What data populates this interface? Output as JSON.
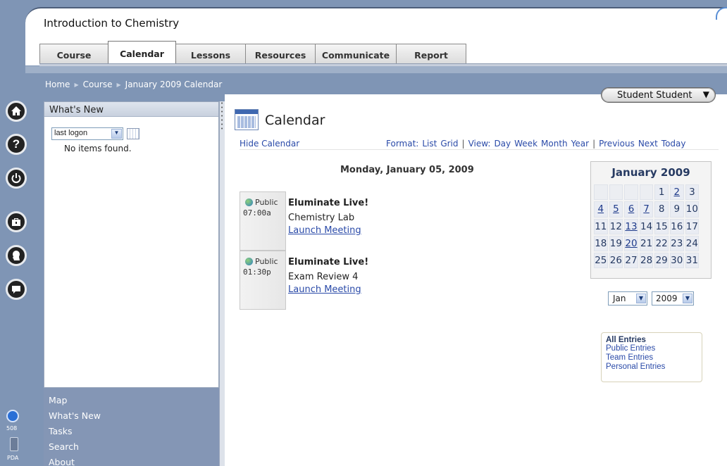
{
  "course": {
    "title": "Introduction to Chemistry"
  },
  "tabs": [
    {
      "label": "Course",
      "active": false
    },
    {
      "label": "Calendar",
      "active": true
    },
    {
      "label": "Lessons",
      "active": false
    },
    {
      "label": "Resources",
      "active": false
    },
    {
      "label": "Communicate",
      "active": false
    },
    {
      "label": "Report",
      "active": false
    }
  ],
  "breadcrumb": [
    "Home",
    "Course",
    "January 2009 Calendar"
  ],
  "user": {
    "name": "Student Student"
  },
  "rail": {
    "accessibility_label": "508",
    "pda_label": "PDA"
  },
  "whats_new": {
    "title": "What's New",
    "filter_value": "last logon",
    "empty_text": "No items found."
  },
  "left_nav": [
    "Map",
    "What's New",
    "Tasks",
    "Search",
    "About"
  ],
  "calendar": {
    "title": "Calendar",
    "hide_label": "Hide Calendar",
    "format_label": "Format:",
    "format_list": "List",
    "format_grid": "Grid",
    "view_label": "View:",
    "view_day": "Day",
    "view_week": "Week",
    "view_month": "Month",
    "view_year": "Year",
    "nav_previous": "Previous",
    "nav_next": "Next",
    "nav_today": "Today",
    "day_heading": "Monday, January 05, 2009",
    "events": [
      {
        "visibility": "Public",
        "time": "07:00a",
        "title": "Eluminate Live!",
        "subtitle": "Chemistry Lab",
        "link": "Launch Meeting"
      },
      {
        "visibility": "Public",
        "time": "01:30p",
        "title": "Eluminate Live!",
        "subtitle": "Exam Review 4",
        "link": "Launch Meeting"
      }
    ],
    "mini": {
      "title": "January 2009",
      "cells": [
        "",
        "",
        "",
        "",
        "1",
        "2",
        "3",
        "4",
        "5",
        "6",
        "7",
        "8",
        "9",
        "10",
        "11",
        "12",
        "13",
        "14",
        "15",
        "16",
        "17",
        "18",
        "19",
        "20",
        "21",
        "22",
        "23",
        "24",
        "25",
        "26",
        "27",
        "28",
        "29",
        "30",
        "31"
      ],
      "linked_days": [
        "2",
        "4",
        "5",
        "6",
        "7",
        "13",
        "20"
      ]
    },
    "month_select": "Jan",
    "year_select": "2009",
    "filters": {
      "all": "All Entries",
      "items": [
        "Public Entries",
        "Team Entries",
        "Personal Entries"
      ]
    }
  }
}
